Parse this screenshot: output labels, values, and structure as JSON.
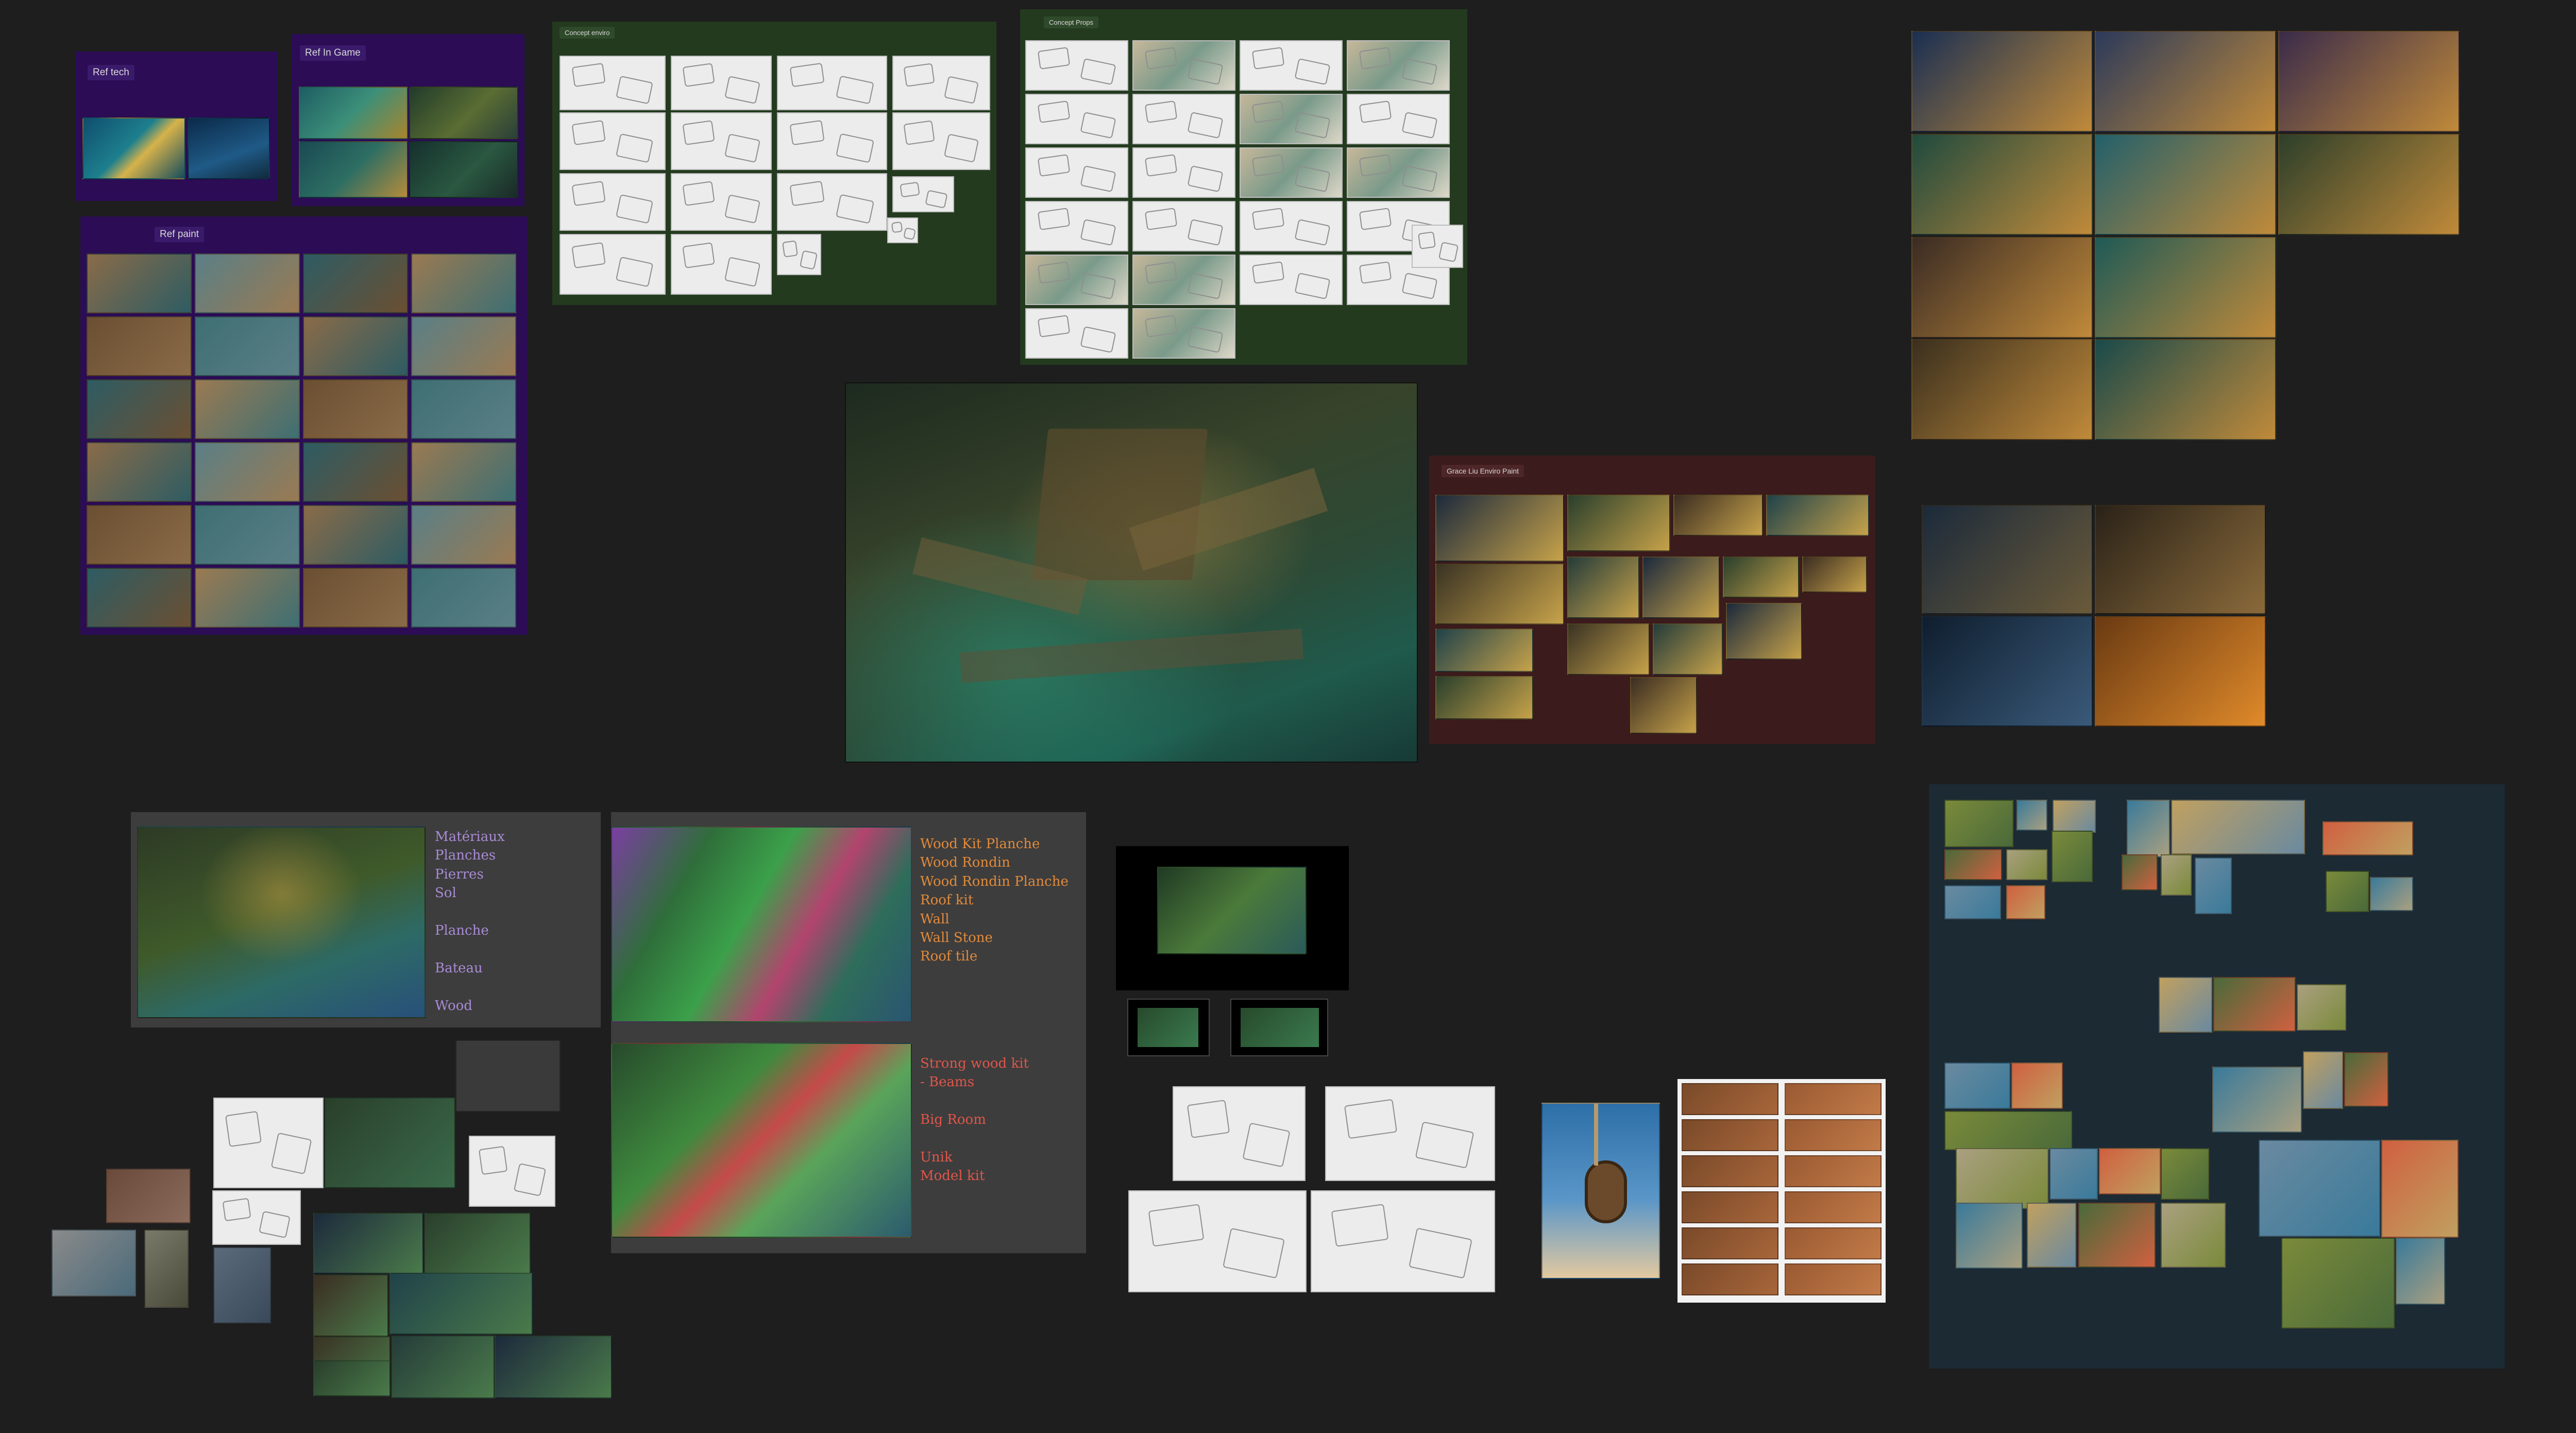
{
  "canvas": {
    "background": "#1e1e1e",
    "colors": {
      "purple_board": "#2b0c55",
      "green_board": "#233a1f",
      "red_board": "#3b1b1c",
      "teal_board": "#2c4748",
      "gray_board": "#3d3d3d",
      "navy_board": "#1c2a34"
    }
  },
  "boards": {
    "ref_tech": {
      "title": "Ref tech"
    },
    "ref_in_game": {
      "title": "Ref In Game"
    },
    "ref_paint": {
      "title": "Ref paint"
    },
    "concept_enviro": {
      "title": "Concept enviro"
    },
    "concept_props": {
      "title": "Concept Props"
    },
    "grace_liu": {
      "title": "Grace Liu Enviro Paint"
    }
  },
  "annotations": {
    "note_a": "Matériaux\nPlanches\nPierres\nSol\n\nPlanche\n\nBateau\n\nWood",
    "note_b": "Wood Kit Planche\nWood Rondin\nWood Rondin Planche\nRoof kit\nWall\nWall Stone\nRoof tile",
    "note_c": "Strong wood kit\n- Beams\n\nBig Room\n\nUnik\nModel kit"
  },
  "icons": {
    "handwriting": "handwriting-icon",
    "thumbnail": "image-thumbnail-icon"
  }
}
